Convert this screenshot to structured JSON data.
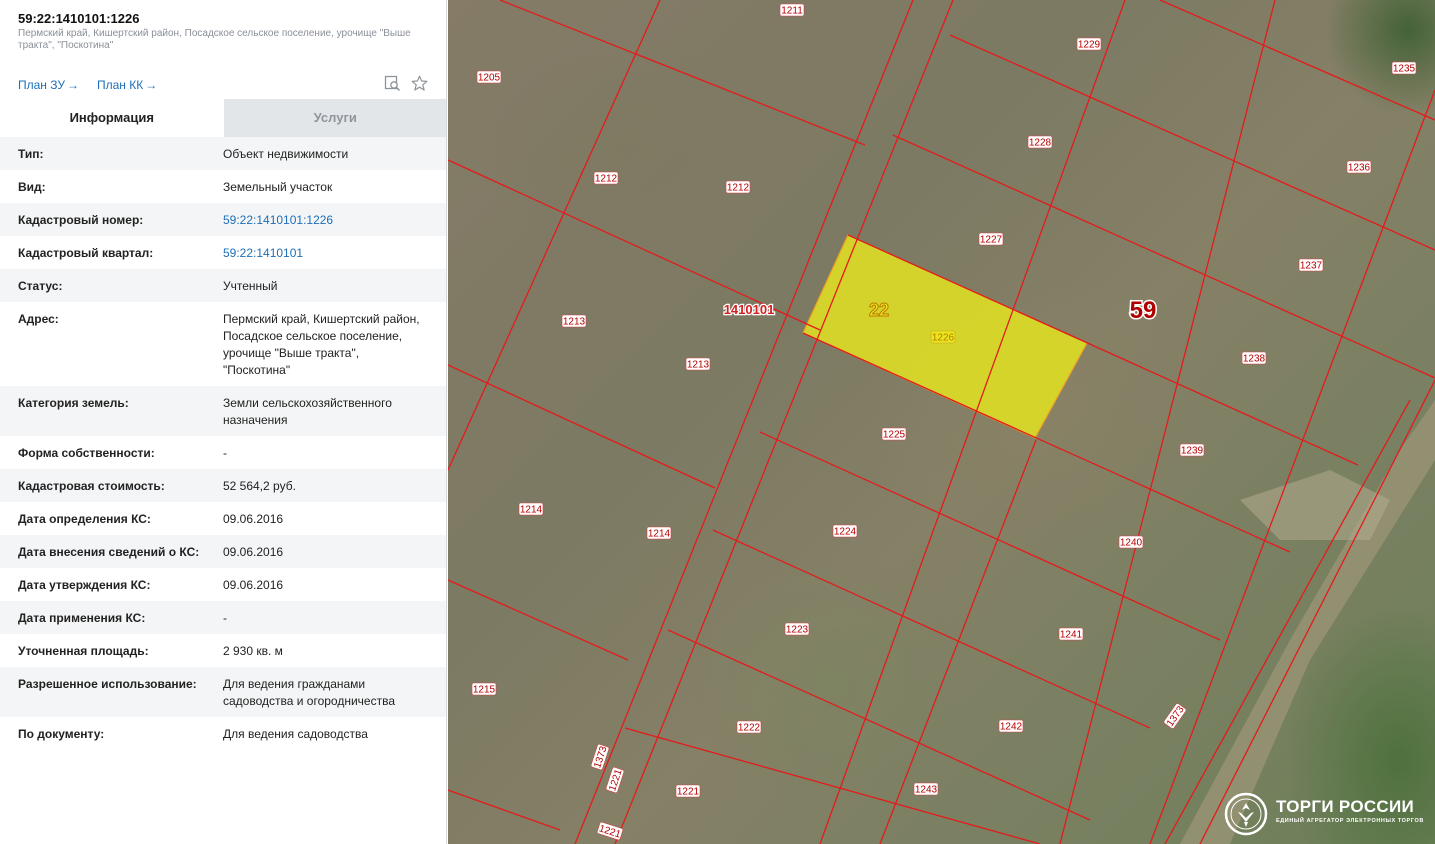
{
  "header": {
    "title": "59:22:1410101:1226",
    "subtitle": "Пермский край, Кишертский район, Посадское сельское поселение, урочище \"Выше тракта\", \"Поскотина\"",
    "plan_zu": "План ЗУ",
    "plan_kk": "План КК",
    "arrow": "→"
  },
  "tabs": {
    "info": "Информация",
    "services": "Услуги"
  },
  "details": [
    {
      "label": "Тип:",
      "value": "Объект недвижимости"
    },
    {
      "label": "Вид:",
      "value": "Земельный участок"
    },
    {
      "label": "Кадастровый номер:",
      "value": "59:22:1410101:1226"
    },
    {
      "label": "Кадастровый квартал:",
      "value": "59:22:1410101"
    },
    {
      "label": "Статус:",
      "value": "Учтенный"
    },
    {
      "label": "Адрес:",
      "value": "Пермский край, Кишертский район, Посадское сельское поселение, урочище \"Выше тракта\", \"Поскотина\""
    },
    {
      "label": "Категория земель:",
      "value": "Земли сельскохозяйственного назначения"
    },
    {
      "label": "Форма собственности:",
      "value": "-"
    },
    {
      "label": "Кадастровая стоимость:",
      "value": "52 564,2 руб."
    },
    {
      "label": "Дата определения КС:",
      "value": "09.06.2016"
    },
    {
      "label": "Дата внесения сведений о КС:",
      "value": "09.06.2016"
    },
    {
      "label": "Дата утверждения КС:",
      "value": "09.06.2016"
    },
    {
      "label": "Дата применения КС:",
      "value": "-"
    },
    {
      "label": "Уточненная площадь:",
      "value": "2 930 кв. м"
    },
    {
      "label": "Разрешенное использование:",
      "value": "Для ведения гражданами садоводства и огородничества"
    },
    {
      "label": "По документу:",
      "value": "Для ведения садоводства"
    }
  ],
  "map": {
    "parcel_labels": [
      "1211",
      "1205",
      "1229",
      "1235",
      "1228",
      "1236",
      "1212",
      "1212",
      "1227",
      "1237",
      "1213",
      "1213",
      "1226",
      "1238",
      "1225",
      "1239",
      "1214",
      "1214",
      "1224",
      "1240",
      "1223",
      "1241",
      "1215",
      "1222",
      "1242",
      "1373",
      "1221",
      "1221",
      "1243",
      "1373",
      "1221"
    ],
    "quarter_label": "1410101",
    "region_code": "59",
    "district_code": "22",
    "colors": {
      "boundary": "#e41b1b",
      "highlight": "#e6e61e"
    }
  },
  "logo": {
    "title": "ТОРГИ РОССИИ",
    "subtitle": "ЕДИНЫЙ АГРЕГАТОР ЭЛЕКТРОННЫХ ТОРГОВ"
  }
}
